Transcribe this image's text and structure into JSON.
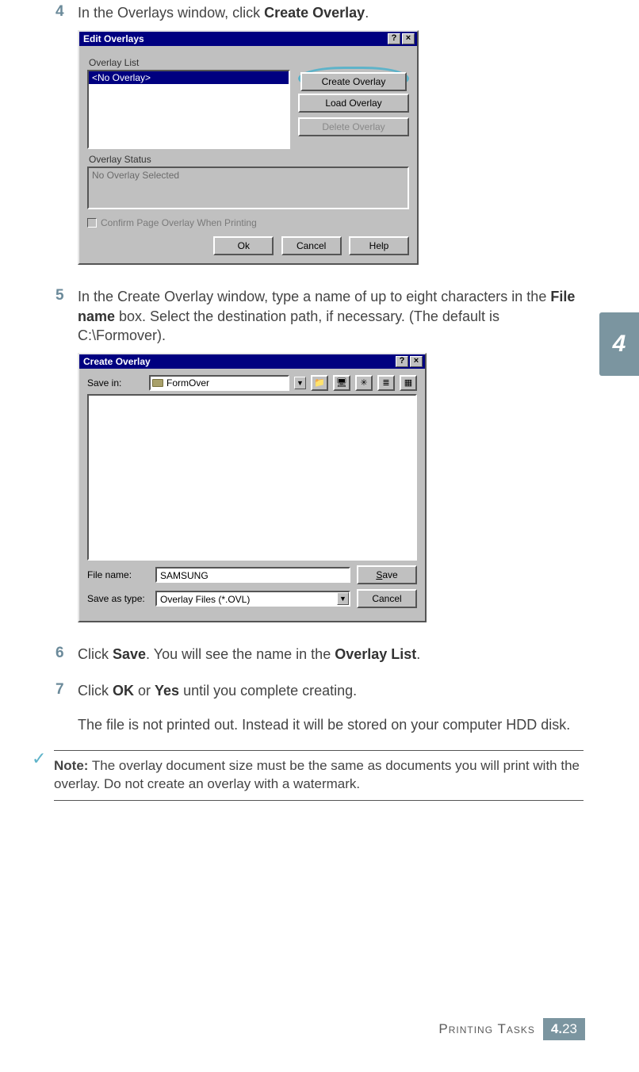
{
  "steps": {
    "s4": {
      "num": "4",
      "t1": "In the Overlays window, click ",
      "b1": "Create Overlay",
      "t2": "."
    },
    "s5": {
      "num": "5",
      "t1": "In the Create Overlay window, type a name of up to eight characters in the ",
      "b1": "File name",
      "t2": " box. Select the destination path, if necessary. (The default is C:\\Formover)."
    },
    "s6": {
      "num": "6",
      "t1": "Click ",
      "b1": "Save",
      "t2": ". You will see the name in the ",
      "b2": "Overlay List",
      "t3": "."
    },
    "s7": {
      "num": "7",
      "t1": "Click ",
      "b1": "OK",
      "t2": " or ",
      "b2": "Yes",
      "t3": " until you complete creating."
    },
    "s7b": "The file is not printed out. Instead it will be stored on your computer HDD disk."
  },
  "dlg1": {
    "title": "Edit Overlays",
    "help": "?",
    "close": "×",
    "overlay_list_lbl": "Overlay List",
    "no_overlay": "<No Overlay>",
    "create": "Create Overlay",
    "load": "Load Overlay",
    "delete": "Delete Overlay",
    "status_lbl": "Overlay Status",
    "status_val": "No Overlay Selected",
    "confirm": "Confirm Page Overlay When Printing",
    "ok": "Ok",
    "cancel": "Cancel",
    "helpbtn": "Help"
  },
  "dlg2": {
    "title": "Create Overlay",
    "help": "?",
    "close": "×",
    "save_in": "Save in:",
    "folder": "FormOver",
    "file_name_lbl": "File name:",
    "file_name_val": "SAMSUNG",
    "save_as_lbl": "Save as type:",
    "save_as_val": "Overlay Files (*.OVL)",
    "save": "Save",
    "cancel": "Cancel",
    "save_u": "S",
    "cancel_text": "Cancel"
  },
  "note": {
    "label": "Note:",
    "body": " The overlay document size must be the same as documents you will print with the overlay. Do not create an overlay with a watermark."
  },
  "sidetab": "4",
  "footer": {
    "text": "Printing Tasks",
    "chap": "4.",
    "page": "23"
  }
}
